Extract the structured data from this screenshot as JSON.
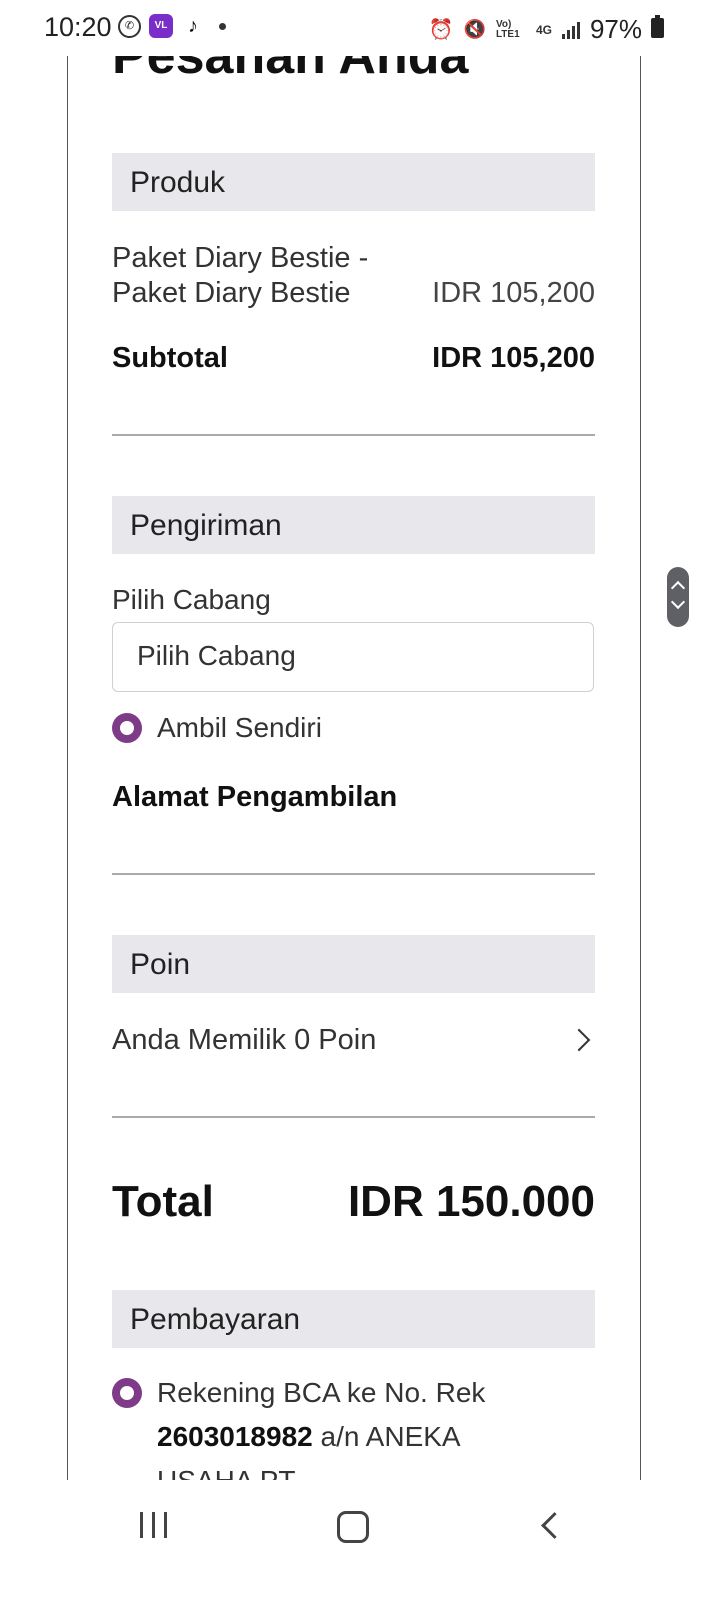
{
  "status_bar": {
    "time": "10:20",
    "battery": "97%",
    "network": "4G",
    "volte": "Vo) LTE1",
    "app_icons": [
      "whatsapp-icon",
      "vl-app-icon",
      "tiktok-icon"
    ]
  },
  "page": {
    "title": "Pesanan Anda"
  },
  "produk": {
    "header": "Produk",
    "items": [
      {
        "name_line1": "Paket Diary Bestie -",
        "name_line2": "Paket Diary Bestie",
        "price": "IDR 105,200"
      }
    ],
    "subtotal_label": "Subtotal",
    "subtotal_value": "IDR 105,200"
  },
  "pengiriman": {
    "header": "Pengiriman",
    "branch_label": "Pilih Cabang",
    "branch_select_value": "Pilih Cabang",
    "option_label": "Ambil Sendiri",
    "pickup_address_label": "Alamat Pengambilan"
  },
  "poin": {
    "header": "Poin",
    "text": "Anda Memilik 0 Poin"
  },
  "total": {
    "label": "Total",
    "value": "IDR 150.000"
  },
  "pembayaran": {
    "header": "Pembayaran",
    "option_prefix": "Rekening BCA ke No. Rek",
    "account_number": "2603018982",
    "account_suffix": "a/n ANEKA",
    "account_line3": "USAHA PT"
  },
  "colors": {
    "accent": "#7e3b87",
    "section_bg": "#e8e7ec"
  }
}
